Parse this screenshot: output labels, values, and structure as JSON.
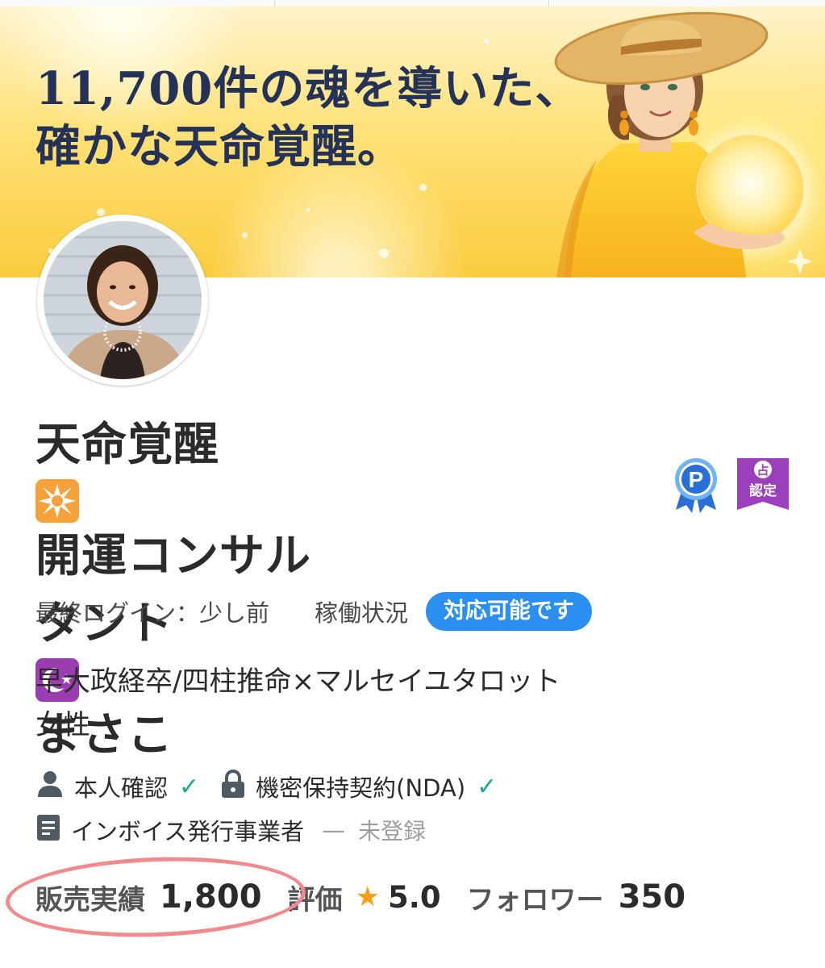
{
  "banner": {
    "headline_line1": "11,700件の魂を導いた、",
    "headline_line2": "確かな天命覚醒。"
  },
  "profile": {
    "name_part1": "天命覚醒",
    "name_part2": "開運コンサル",
    "name_part3": "タント",
    "name_part4": "まさこ",
    "name_emojis": [
      "eight-pointed-star-emoji",
      "star-and-crescent-emoji"
    ],
    "badges": {
      "pro_letter": "P",
      "ura_top": "占",
      "ura_bottom": "認定"
    },
    "last_login_label": "最終ログイン：",
    "last_login_value": "少し前",
    "status_label": "稼働状況",
    "status_badge": "対応可能です",
    "bio_line1": "早大政経卒/四柱推命×マルセイユタロット",
    "bio_line2": "女性"
  },
  "verification": {
    "identity": "本人確認",
    "nda": "機密保持契約(NDA)",
    "invoice": "インボイス発行事業者",
    "invoice_dash": "—",
    "invoice_status": "未登録"
  },
  "stats": {
    "sales_label": "販売実績",
    "sales_value": "1,800",
    "rating_label": "評価",
    "rating_value": "5.0",
    "followers_label": "フォロワー",
    "followers_value": "350"
  },
  "colors": {
    "accent_blue": "#2b8ff1",
    "check_green": "#1aa88f",
    "annotation_pink": "#f2898d",
    "star_orange": "#f6a018",
    "headline_navy": "#233256"
  }
}
